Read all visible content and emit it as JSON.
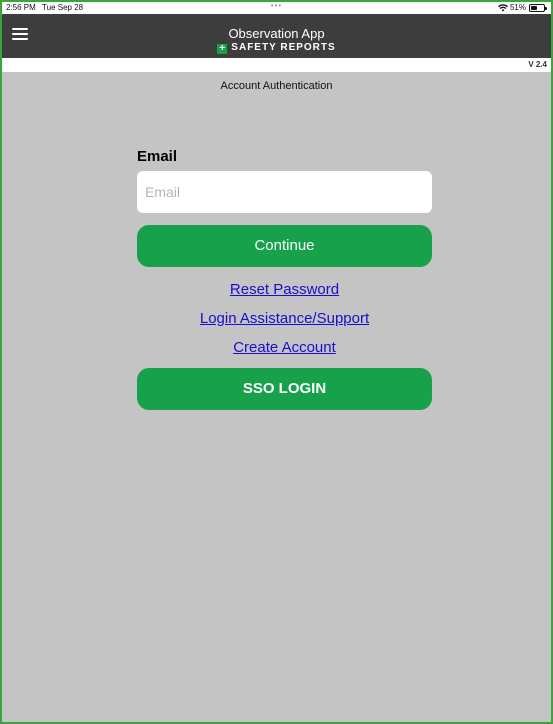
{
  "status_bar": {
    "time": "2:56 PM",
    "date": "Tue Sep 28",
    "dots": "•••",
    "battery_percent": "51%",
    "battery_level": 0.51
  },
  "app_bar": {
    "title": "Observation App",
    "brand": "SAFETY REPORTS",
    "brand_icon": "+",
    "menu_icon": "hamburger-menu-icon"
  },
  "version": "V 2.4",
  "subheading": "Account Authentication",
  "form": {
    "email_label": "Email",
    "email_placeholder": "Email",
    "email_value": "",
    "continue_label": "Continue",
    "reset_password_label": "Reset Password",
    "login_assistance_label": "Login Assistance/Support",
    "create_account_label": "Create Account",
    "sso_label": "SSO LOGIN"
  },
  "colors": {
    "accent": "#17a14a",
    "frame_border": "#3aa63a",
    "app_bar": "#3d3d3d",
    "background": "#c4c4c4",
    "link": "#1a0dcc"
  }
}
